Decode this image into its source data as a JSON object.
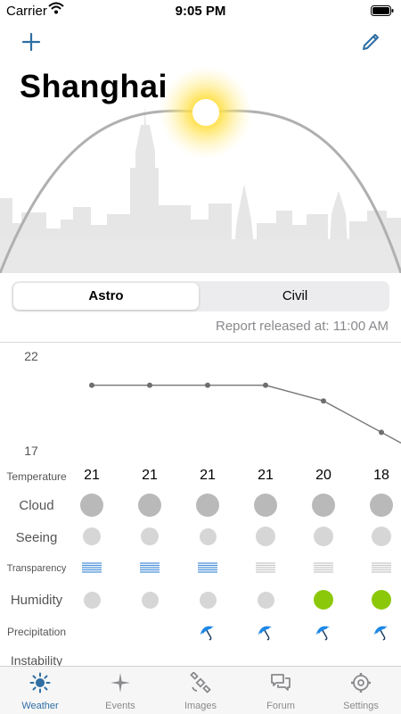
{
  "status": {
    "carrier": "Carrier",
    "time": "9:05 PM"
  },
  "city": "Shanghai",
  "segments": [
    "Astro",
    "Civil"
  ],
  "report": {
    "label": "Report released at:",
    "time": "11:00 AM"
  },
  "chart_data": {
    "type": "line",
    "title": "",
    "x": [
      1,
      2,
      3,
      4,
      5,
      6
    ],
    "values": [
      21,
      21,
      21,
      21,
      20,
      18
    ],
    "ylim": [
      17,
      22
    ],
    "ytick_labels": [
      "22",
      "17"
    ],
    "grid": false
  },
  "rows": {
    "temperature_label": "Temperature",
    "cloud_label": "Cloud",
    "seeing_label": "Seeing",
    "transparency_label": "Transparency",
    "humidity_label": "Humidity",
    "precipitation_label": "Precipitation",
    "instability_label": "Instability"
  },
  "temperatures": [
    "21",
    "21",
    "21",
    "21",
    "20",
    "18"
  ],
  "colors": {
    "accent": "#2e6ea3",
    "cloud": "#b9b9b9",
    "seeing": "#d6d6d6",
    "humidity_high": "#8cc80a",
    "transparency_good": "#4a90d9",
    "transparency_poor": "#c8c8c8",
    "umbrella": "#1e88e5"
  },
  "humidity_levels": [
    "low",
    "low",
    "low",
    "low",
    "high",
    "high"
  ],
  "transparency_levels": [
    "good",
    "good",
    "good",
    "poor",
    "poor",
    "poor"
  ],
  "precipitation": [
    false,
    false,
    true,
    true,
    true,
    true
  ],
  "tabs": [
    {
      "label": "Weather",
      "icon": "sun-icon",
      "active": true
    },
    {
      "label": "Events",
      "icon": "sparkle-icon",
      "active": false
    },
    {
      "label": "Images",
      "icon": "satellite-icon",
      "active": false
    },
    {
      "label": "Forum",
      "icon": "chat-bubbles-icon",
      "active": false
    },
    {
      "label": "Settings",
      "icon": "gear-icon",
      "active": false
    }
  ]
}
